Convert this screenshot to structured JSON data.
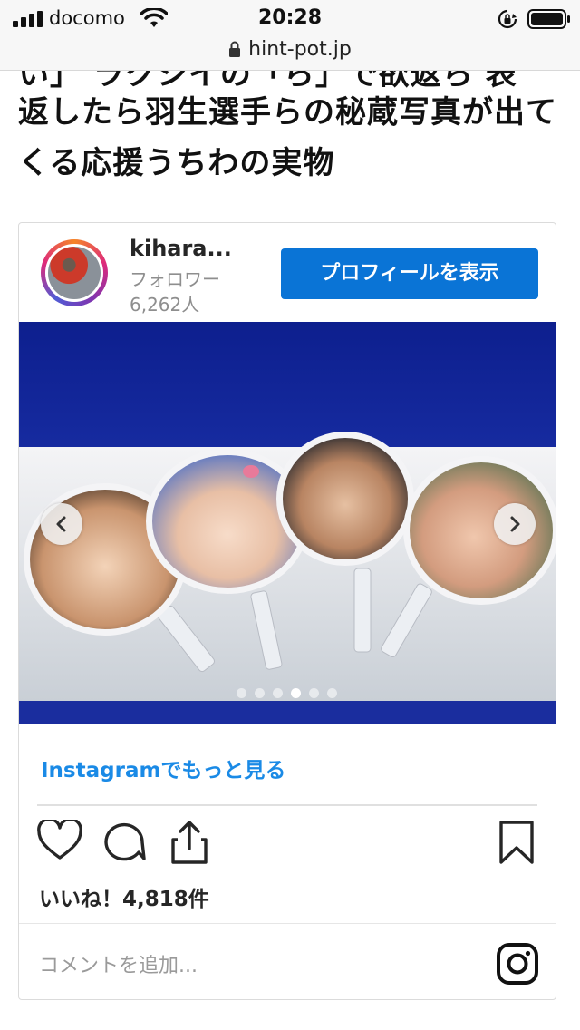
{
  "status_bar": {
    "carrier": "docomo",
    "time": "20:28",
    "icons": [
      "signal-bars-icon",
      "wifi-icon",
      "rotation-lock-icon",
      "battery-icon"
    ]
  },
  "url_bar": {
    "url": "hint-pot.jp",
    "icon": "padlock-icon"
  },
  "article": {
    "title_cut_line": "い」  ラクシイの「ら」で欲返ら  表",
    "title": "返したら羽生選手らの秘蔵写真が出てくる応援うちわの実物"
  },
  "embed": {
    "username": "kihara...",
    "followers_label": "フォロワー",
    "followers_count": "6,262人",
    "profile_button": "プロフィールを表示",
    "carousel": {
      "dot_count": 6,
      "active_index": 3
    },
    "more_link": "Instagramでもっと見る",
    "likes": "いいね！4,818件",
    "comment_placeholder": "コメントを追加...",
    "colors": {
      "button": "#0a74d6",
      "link": "#1a8ae6",
      "backdrop": "#1a2fa8"
    },
    "icons": [
      "heart-icon",
      "comment-icon",
      "share-icon",
      "bookmark-icon",
      "instagram-logo-icon",
      "chevron-left-icon",
      "chevron-right-icon"
    ]
  }
}
